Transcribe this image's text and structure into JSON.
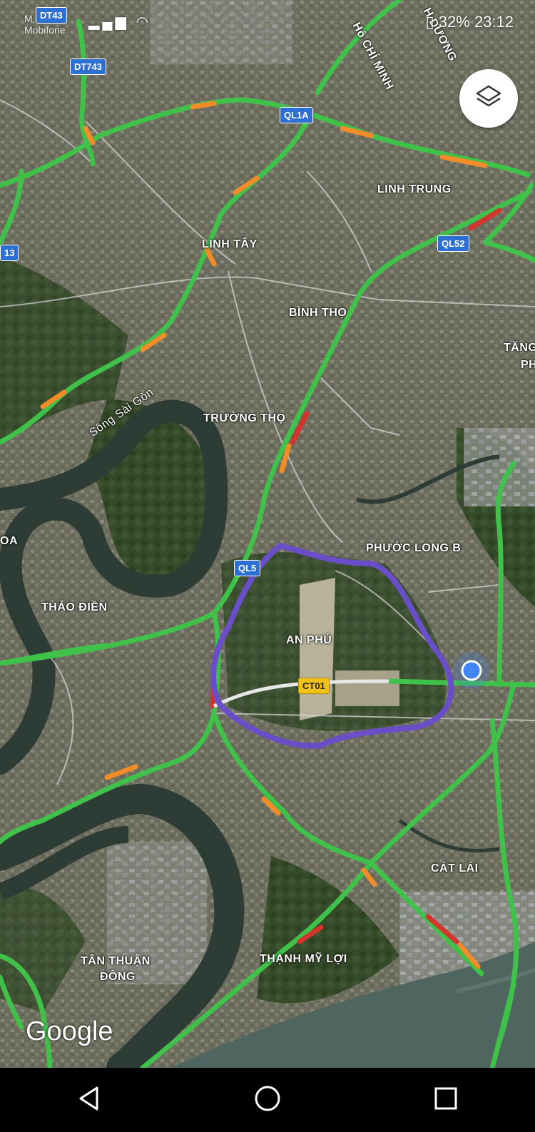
{
  "status_bar": {
    "carrier_line1": "M",
    "carrier_line2": "Mobifone",
    "battery": "32%",
    "time": "23:12"
  },
  "map": {
    "place_labels": [
      {
        "key": "linh_tay",
        "text": "LINH TÂY"
      },
      {
        "key": "linh_trung",
        "text": "LINH TRUNG"
      },
      {
        "key": "binh_tho",
        "text": "BÌNH THỌ"
      },
      {
        "key": "tang",
        "text": "TĂNG"
      },
      {
        "key": "ph",
        "text": "PH"
      },
      {
        "key": "truong_tho",
        "text": "TRƯỜNG THỌ"
      },
      {
        "key": "phuoc_long_b",
        "text": "PHƯỚC LONG B"
      },
      {
        "key": "thao_dien",
        "text": "THẢO ĐIỀN"
      },
      {
        "key": "an_phu",
        "text": "AN PHÚ"
      },
      {
        "key": "oa",
        "text": "OA"
      },
      {
        "key": "cat_lai",
        "text": "CÁT LÁI"
      },
      {
        "key": "tan_thuan",
        "text": "TÂN THUẬN"
      },
      {
        "key": "dong",
        "text": "ĐÔNG"
      },
      {
        "key": "thanh_my_loi",
        "text": "THẠNH MỸ LỢI"
      },
      {
        "key": "song_sai_gon",
        "text": "Sông Sài Gòn"
      },
      {
        "key": "ho_chi_minh",
        "text": "Hồ CHÍ MINH"
      },
      {
        "key": "binh_duong",
        "text": "H DƯƠNG"
      }
    ],
    "route_shields": [
      {
        "key": "dt743",
        "text": "DT743"
      },
      {
        "key": "dt743_top",
        "text": "DT43"
      },
      {
        "key": "ql1a",
        "text": "QL1A"
      },
      {
        "key": "ql52",
        "text": "QL52"
      },
      {
        "key": "ql52_b",
        "text": "QL5"
      },
      {
        "key": "r13",
        "text": "13"
      },
      {
        "key": "ct01",
        "text": "CT01"
      }
    ],
    "attribution": "Google"
  },
  "colors": {
    "traffic_green": "#3fc14a",
    "traffic_orange": "#f28c28",
    "traffic_red": "#d3342b",
    "boundary": "#6a4ec8",
    "river": "#2e3c36",
    "location_dot": "#4285f4"
  },
  "controls": {
    "layers_icon": "layers-icon",
    "nav_back_icon": "triangle-back-icon",
    "nav_home_icon": "circle-home-icon",
    "nav_recents_icon": "square-recents-icon"
  }
}
